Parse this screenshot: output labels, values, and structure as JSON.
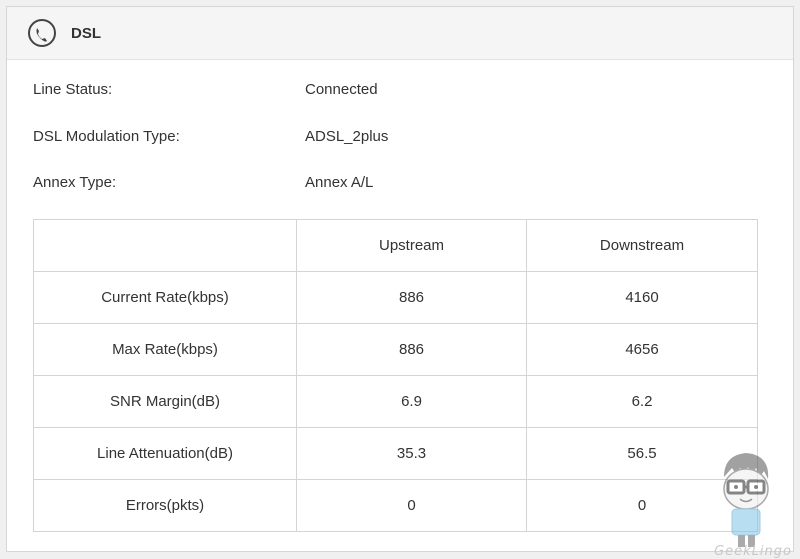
{
  "header": {
    "title": "DSL",
    "icon": "dsl-phone-icon"
  },
  "info": [
    {
      "label": "Line Status:",
      "value": "Connected"
    },
    {
      "label": "DSL Modulation Type:",
      "value": "ADSL_2plus"
    },
    {
      "label": "Annex Type:",
      "value": "Annex A/L"
    }
  ],
  "table": {
    "columns": [
      "",
      "Upstream",
      "Downstream"
    ],
    "rows": [
      {
        "label": "Current Rate(kbps)",
        "upstream": "886",
        "downstream": "4160"
      },
      {
        "label": "Max Rate(kbps)",
        "upstream": "886",
        "downstream": "4656"
      },
      {
        "label": "SNR Margin(dB)",
        "upstream": "6.9",
        "downstream": "6.2"
      },
      {
        "label": "Line Attenuation(dB)",
        "upstream": "35.3",
        "downstream": "56.5"
      },
      {
        "label": "Errors(pkts)",
        "upstream": "0",
        "downstream": "0"
      }
    ]
  },
  "watermark": {
    "brand": "GeekLingo"
  }
}
